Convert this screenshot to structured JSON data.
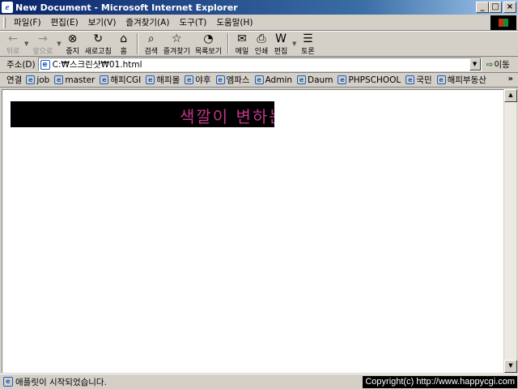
{
  "window": {
    "title": "New Document - Microsoft Internet Explorer",
    "app_icon": "ie-icon",
    "buttons": {
      "minimize": "_",
      "maximize": "□",
      "close": "×"
    }
  },
  "menu": {
    "items": [
      {
        "label": "파일(F)"
      },
      {
        "label": "편집(E)"
      },
      {
        "label": "보기(V)"
      },
      {
        "label": "즐겨찾기(A)"
      },
      {
        "label": "도구(T)"
      },
      {
        "label": "도움말(H)"
      }
    ]
  },
  "toolbar": {
    "back": {
      "label": "뒤로",
      "icon": "back-arrow-icon"
    },
    "forward": {
      "label": "앞으로",
      "icon": "forward-arrow-icon"
    },
    "stop": {
      "label": "중지",
      "icon": "stop-icon"
    },
    "refresh": {
      "label": "새로고침",
      "icon": "refresh-icon"
    },
    "home": {
      "label": "홈",
      "icon": "home-icon"
    },
    "search": {
      "label": "검색",
      "icon": "search-icon"
    },
    "favorites": {
      "label": "즐겨찾기",
      "icon": "favorites-icon"
    },
    "history": {
      "label": "목록보기",
      "icon": "history-icon"
    },
    "mail": {
      "label": "메일",
      "icon": "mail-icon"
    },
    "print": {
      "label": "인쇄",
      "icon": "print-icon"
    },
    "edit": {
      "label": "편집",
      "icon": "edit-icon"
    },
    "discuss": {
      "label": "토론",
      "icon": "discuss-icon"
    }
  },
  "address": {
    "label": "주소(D)",
    "value": "C:₩스크린샷₩01.html",
    "go_label": "이동"
  },
  "links": {
    "label": "연결",
    "items": [
      {
        "label": "job"
      },
      {
        "label": "master"
      },
      {
        "label": "해피CGI"
      },
      {
        "label": "해피몰"
      },
      {
        "label": "야후"
      },
      {
        "label": "엠파스"
      },
      {
        "label": "Admin"
      },
      {
        "label": "Daum"
      },
      {
        "label": "PHPSCHOOL"
      },
      {
        "label": "국민"
      },
      {
        "label": "해피부동산"
      }
    ],
    "more": "»"
  },
  "content": {
    "marquee_text": "색깔이 변하는",
    "marquee_bg": "#000000",
    "marquee_color": "#c3358a"
  },
  "status": {
    "text": "애플릿이 시작되었습니다.",
    "watermark": "Copyright(c) http://www.happycgi.com"
  }
}
